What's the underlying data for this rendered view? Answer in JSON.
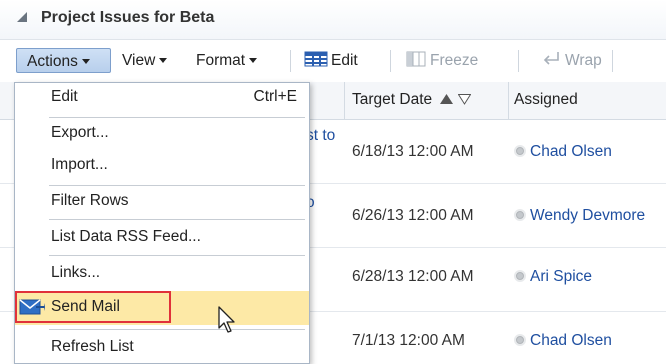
{
  "panel": {
    "title": "Project Issues for Beta"
  },
  "toolbar": {
    "actions_label": "Actions",
    "view_label": "View",
    "format_label": "Format",
    "edit_label": "Edit",
    "freeze_label": "Freeze",
    "wrap_label": "Wrap"
  },
  "columns": {
    "target_date": "Target Date",
    "assigned": "Assigned"
  },
  "rows": [
    {
      "trunc": "st to",
      "date": "6/18/13 12:00 AM",
      "assigned": "Chad Olsen"
    },
    {
      "trunc": "o",
      "date": "6/26/13 12:00 AM",
      "assigned": "Wendy Devmore"
    },
    {
      "trunc": "",
      "date": "6/28/13 12:00 AM",
      "assigned": "Ari Spice"
    },
    {
      "trunc": "",
      "date": "7/1/13 12:00 AM",
      "assigned": "Chad Olsen"
    }
  ],
  "menu": {
    "items": [
      {
        "label": "Edit",
        "accel": "Ctrl+E"
      },
      {
        "label": "Export..."
      },
      {
        "label": "Import..."
      },
      {
        "label": "Filter Rows"
      },
      {
        "label": "List Data RSS Feed..."
      },
      {
        "label": "Links..."
      },
      {
        "label": "Send Mail"
      },
      {
        "label": "Refresh List"
      }
    ]
  },
  "colors": {
    "highlight": "#fde9a6",
    "outline_red": "#e0313a",
    "link_blue": "#1f4fa0",
    "actions_bg": "#b8cfec"
  },
  "icons": [
    "collapse-triangle-icon",
    "table-edit-icon",
    "freeze-icon",
    "wrap-icon",
    "mail-icon",
    "status-dot-icon",
    "mouse-cursor-icon"
  ]
}
